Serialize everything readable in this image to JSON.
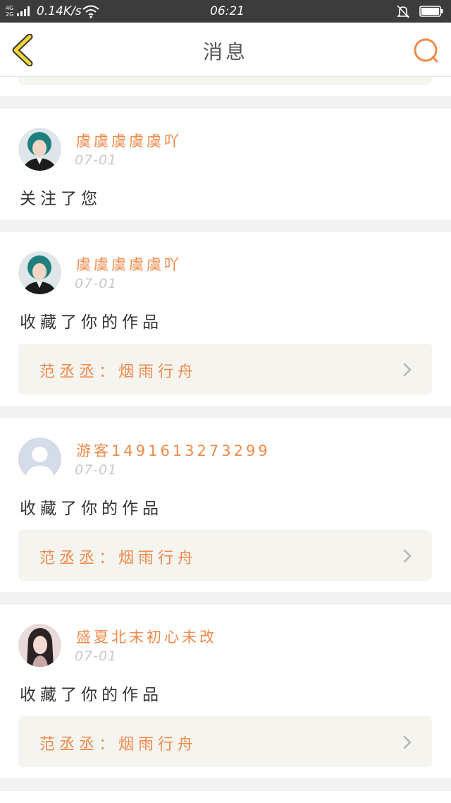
{
  "status_bar": {
    "network_top": "4G",
    "network_bottom": "2G",
    "speed": "0.14K/s",
    "time": "06:21",
    "icons": [
      "signal-icon",
      "wifi-icon",
      "bell-muted-icon",
      "battery-icon"
    ]
  },
  "header": {
    "title": "消息",
    "back_icon": "chevron-left-icon",
    "search_icon": "search-icon"
  },
  "colors": {
    "accent": "#f08a4b",
    "back_icon": "#f3d63a",
    "status_bar_bg": "#3c3c3c",
    "reference_bg": "#f5f4ef"
  },
  "notifications": [
    {
      "username": "虞虞虞虞虞吖",
      "date": "07-01",
      "action": "关注了您",
      "avatar": "teal-hair-avatar"
    },
    {
      "username": "虞虞虞虞虞吖",
      "date": "07-01",
      "action": "收藏了你的作品",
      "reference": "范丞丞：烟雨行舟",
      "avatar": "teal-hair-avatar"
    },
    {
      "username": "游客1491613273299",
      "date": "07-01",
      "action": "收藏了你的作品",
      "reference": "范丞丞：烟雨行舟",
      "avatar": "default-avatar"
    },
    {
      "username": "盛夏北末初心未改",
      "date": "07-01",
      "action": "收藏了你的作品",
      "reference": "范丞丞：烟雨行舟",
      "avatar": "girl-photo-avatar"
    }
  ]
}
